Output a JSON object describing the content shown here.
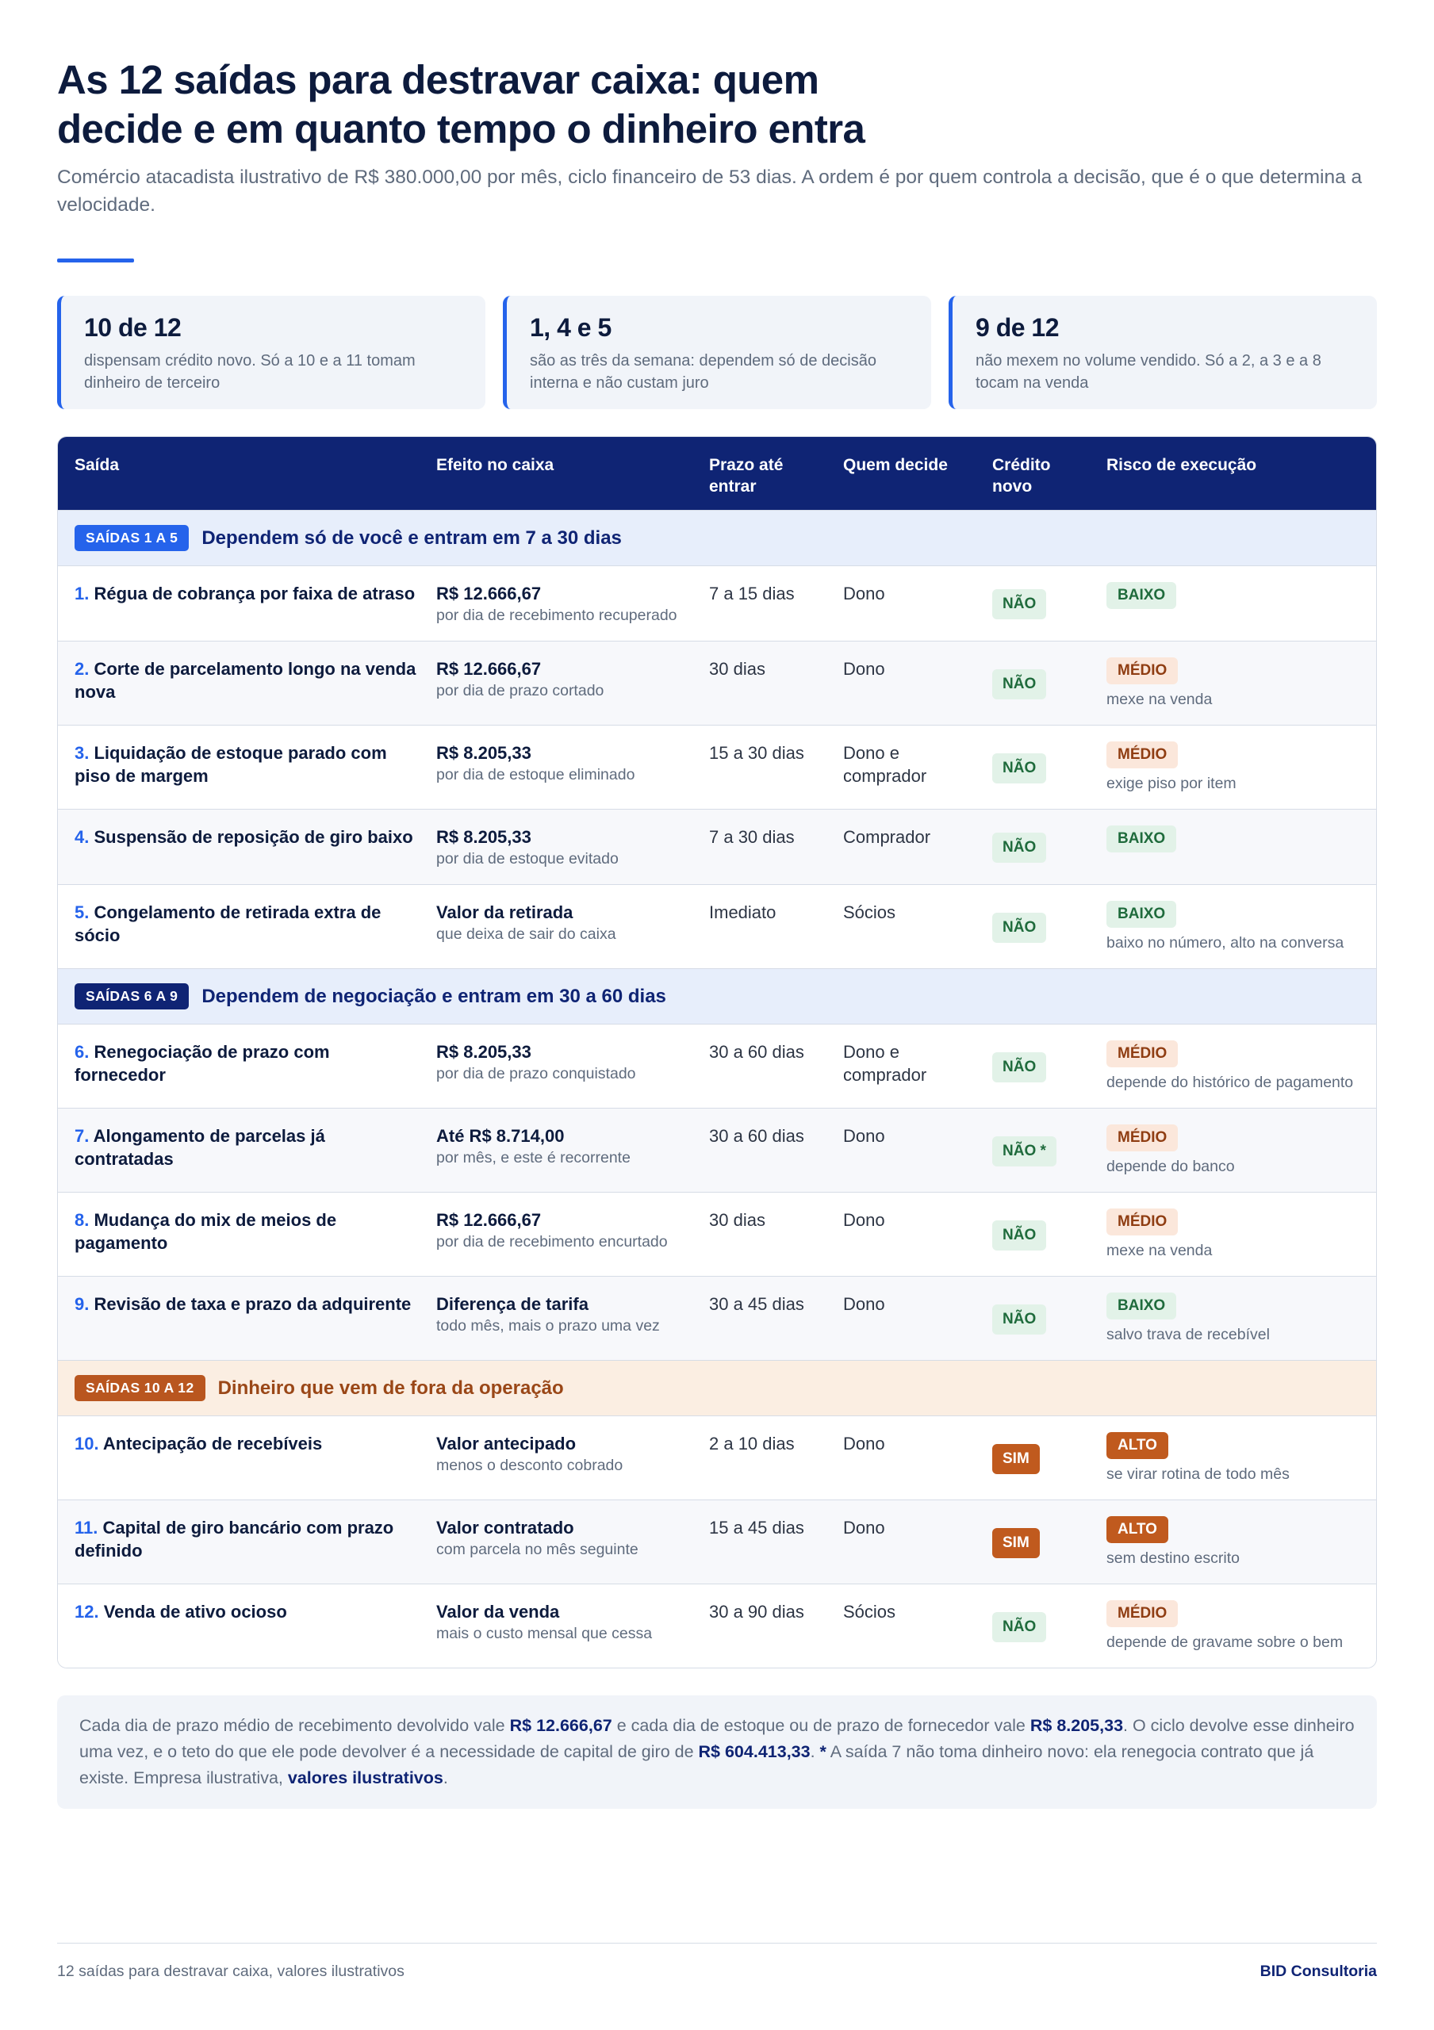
{
  "title_line1": "As 12 saídas para destravar caixa: quem",
  "title_line2": "decide e em quanto tempo o dinheiro entra",
  "subtitle": "Comércio atacadista ilustrativo de R$ 380.000,00 por mês, ciclo financeiro de 53 dias. A ordem é por quem controla a decisão, que é o que determina a velocidade.",
  "stats": [
    {
      "value": "10 de 12",
      "desc": "dispensam crédito novo. Só a 10 e a 11 tomam dinheiro de terceiro"
    },
    {
      "value": "1, 4 e 5",
      "desc": "são as três da semana: dependem só de decisão interna e não custam juro"
    },
    {
      "value": "9 de 12",
      "desc": "não mexem no volume vendido. Só a 2, a 3 e a 8 tocam na venda"
    }
  ],
  "table": {
    "headers": [
      "Saída",
      "Efeito no caixa",
      "Prazo até entrar",
      "Quem decide",
      "Crédito novo",
      "Risco de execução"
    ],
    "sections": [
      {
        "badge": "SAÍDAS 1 A 5",
        "title": "Dependem só de você e entram em 7 a 30 dias",
        "rows": [
          {
            "num": "1.",
            "name": "Régua de cobrança por faixa de atraso",
            "effect": "R$ 12.666,67",
            "effect_sub": "por dia de recebimento recuperado",
            "prazo": "7 a 15 dias",
            "quem": "Dono",
            "credito": "NÃO",
            "risco": "BAIXO",
            "risco_note": ""
          },
          {
            "num": "2.",
            "name": "Corte de parcelamento longo na venda nova",
            "effect": "R$ 12.666,67",
            "effect_sub": "por dia de prazo cortado",
            "prazo": "30 dias",
            "quem": "Dono",
            "credito": "NÃO",
            "risco": "MÉDIO",
            "risco_note": "mexe na venda"
          },
          {
            "num": "3.",
            "name": "Liquidação de estoque parado com piso de margem",
            "effect": "R$ 8.205,33",
            "effect_sub": "por dia de estoque eliminado",
            "prazo": "15 a 30 dias",
            "quem": "Dono e comprador",
            "credito": "NÃO",
            "risco": "MÉDIO",
            "risco_note": "exige piso por item"
          },
          {
            "num": "4.",
            "name": "Suspensão de reposição de giro baixo",
            "effect": "R$ 8.205,33",
            "effect_sub": "por dia de estoque evitado",
            "prazo": "7 a 30 dias",
            "quem": "Comprador",
            "credito": "NÃO",
            "risco": "BAIXO",
            "risco_note": ""
          },
          {
            "num": "5.",
            "name": "Congelamento de retirada extra de sócio",
            "effect": "Valor da retirada",
            "effect_sub": "que deixa de sair do caixa",
            "prazo": "Imediato",
            "quem": "Sócios",
            "credito": "NÃO",
            "risco": "BAIXO",
            "risco_note": "baixo no número, alto na conversa"
          }
        ]
      },
      {
        "badge": "SAÍDAS 6 A 9",
        "title": "Dependem de negociação e entram em 30 a 60 dias",
        "rows": [
          {
            "num": "6.",
            "name": "Renegociação de prazo com fornecedor",
            "effect": "R$ 8.205,33",
            "effect_sub": "por dia de prazo conquistado",
            "prazo": "30 a 60 dias",
            "quem": "Dono e comprador",
            "credito": "NÃO",
            "risco": "MÉDIO",
            "risco_note": "depende do histórico de pagamento"
          },
          {
            "num": "7.",
            "name": "Alongamento de parcelas já contratadas",
            "effect": "Até R$ 8.714,00",
            "effect_sub": "por mês, e este é recorrente",
            "prazo": "30 a 60 dias",
            "quem": "Dono",
            "credito": "NÃO *",
            "risco": "MÉDIO",
            "risco_note": "depende do banco"
          },
          {
            "num": "8.",
            "name": "Mudança do mix de meios de pagamento",
            "effect": "R$ 12.666,67",
            "effect_sub": "por dia de recebimento encurtado",
            "prazo": "30 dias",
            "quem": "Dono",
            "credito": "NÃO",
            "risco": "MÉDIO",
            "risco_note": "mexe na venda"
          },
          {
            "num": "9.",
            "name": "Revisão de taxa e prazo da adquirente",
            "effect": "Diferença de tarifa",
            "effect_sub": "todo mês, mais o prazo uma vez",
            "prazo": "30 a 45 dias",
            "quem": "Dono",
            "credito": "NÃO",
            "risco": "BAIXO",
            "risco_note": "salvo trava de recebível"
          }
        ]
      },
      {
        "badge": "SAÍDAS 10 A 12",
        "title": "Dinheiro que vem de fora da operação",
        "rows": [
          {
            "num": "10.",
            "name": "Antecipação de recebíveis",
            "effect": "Valor antecipado",
            "effect_sub": "menos o desconto cobrado",
            "prazo": "2 a 10 dias",
            "quem": "Dono",
            "credito": "SIM",
            "risco": "ALTO",
            "risco_note": "se virar rotina de todo mês"
          },
          {
            "num": "11.",
            "name": "Capital de giro bancário com prazo definido",
            "effect": "Valor contratado",
            "effect_sub": "com parcela no mês seguinte",
            "prazo": "15 a 45 dias",
            "quem": "Dono",
            "credito": "SIM",
            "risco": "ALTO",
            "risco_note": "sem destino escrito"
          },
          {
            "num": "12.",
            "name": "Venda de ativo ocioso",
            "effect": "Valor da venda",
            "effect_sub": "mais o custo mensal que cessa",
            "prazo": "30 a 90 dias",
            "quem": "Sócios",
            "credito": "NÃO",
            "risco": "MÉDIO",
            "risco_note": "depende de gravame sobre o bem"
          }
        ]
      }
    ]
  },
  "note": {
    "t1": "Cada dia de prazo médio de recebimento devolvido vale ",
    "v1": "R$ 12.666,67",
    "t2": " e cada dia de estoque ou de prazo de fornecedor vale ",
    "v2": "R$ 8.205,33",
    "t3": ". O ciclo devolve esse dinheiro uma vez, e o teto do que ele pode devolver é a necessidade de capital de giro de ",
    "v3": "R$ 604.413,33",
    "t4": ". ",
    "star": "*",
    "t5": " A saída 7 não toma dinheiro novo: ela renegocia contrato que já existe. Empresa ilustrativa, ",
    "v4": "valores ilustrativos",
    "t6": "."
  },
  "footer": {
    "left": "12 saídas para destravar caixa, valores ilustrativos",
    "right": "BID Consultoria"
  },
  "colors": {
    "accent": "#2563eb",
    "header_navy": "#0f2474",
    "risk_low": "#1f6b3c",
    "risk_medium": "#8f3d12",
    "risk_high": "#c05a1e"
  }
}
